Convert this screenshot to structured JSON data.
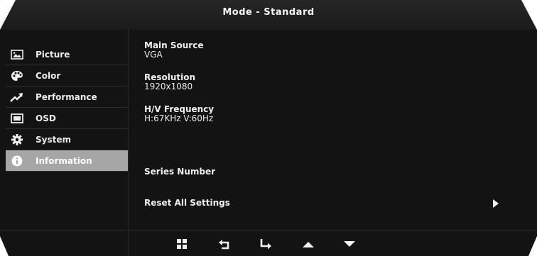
{
  "header": {
    "title": "Mode - Standard"
  },
  "sidebar": {
    "items": [
      {
        "label": "Picture",
        "icon": "picture-icon",
        "active": false
      },
      {
        "label": "Color",
        "icon": "palette-icon",
        "active": false
      },
      {
        "label": "Performance",
        "icon": "trend-arrow-icon",
        "active": false
      },
      {
        "label": "OSD",
        "icon": "osd-icon",
        "active": false
      },
      {
        "label": "System",
        "icon": "gear-icon",
        "active": false
      },
      {
        "label": "Information",
        "icon": "info-icon",
        "active": true
      }
    ]
  },
  "main": {
    "main_source": {
      "label": "Main Source",
      "value": "VGA"
    },
    "resolution": {
      "label": "Resolution",
      "value": "1920x1080"
    },
    "frequency": {
      "label": "H/V Frequency",
      "value": "H:67KHz V:60Hz"
    },
    "series_number": {
      "label": "Series Number"
    },
    "reset": {
      "label": "Reset All Settings",
      "icon": "play-arrow-icon"
    }
  },
  "bottom_bar": {
    "buttons": [
      "menu-grid-icon",
      "back-arrow-icon",
      "enter-arrow-icon",
      "up-triangle-icon",
      "down-triangle-icon"
    ]
  },
  "colors": {
    "background": "#131313",
    "active_item": "#a6a6a6",
    "text": "#f2f2f2"
  }
}
